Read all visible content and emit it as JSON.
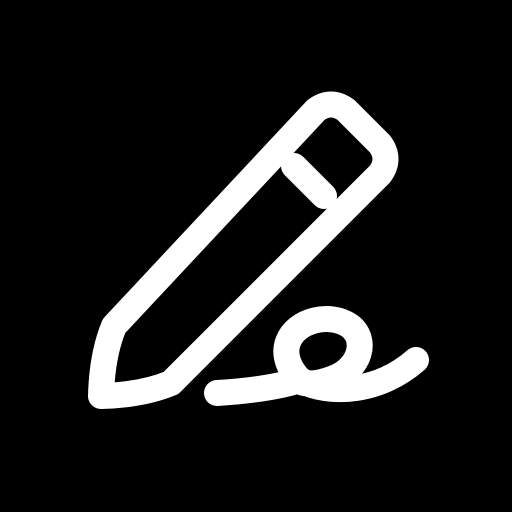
{
  "icon": {
    "name": "pen-signature-icon",
    "background_color": "#000000",
    "stroke_color": "#FFFFFF"
  }
}
